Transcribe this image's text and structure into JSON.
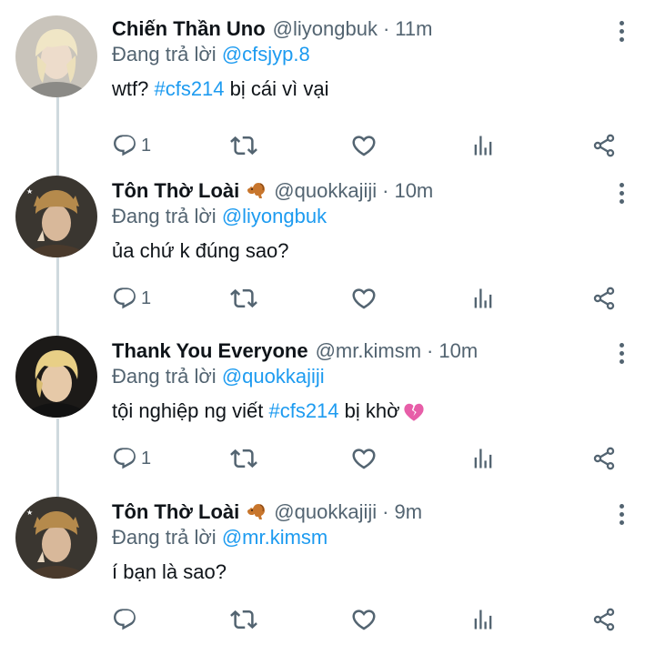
{
  "tweets": [
    {
      "name": "Chiến Thần Uno",
      "handle": "@liyongbuk",
      "separator": "·",
      "time": "11m",
      "reply_prefix": "Đang trả lời",
      "reply_to": "@cfsjyp.8",
      "text_before": "wtf? ",
      "hashtag": "#cfs214",
      "text_after": " bị cái vì vại",
      "reply_count": "1",
      "avatar": "avatar-blonde-person",
      "has_squirrel": false
    },
    {
      "name": "Tôn Thờ Loài",
      "handle": "@quokkajiji",
      "separator": "·",
      "time": "10m",
      "reply_prefix": "Đang trả lời",
      "reply_to": "@liyongbuk",
      "text": "ủa chứ k đúng sao?",
      "reply_count": "1",
      "avatar": "avatar-cat-hat-person",
      "has_squirrel": true
    },
    {
      "name": "Thank You Everyone",
      "handle": "@mr.kimsm",
      "separator": "·",
      "time": "10m",
      "reply_prefix": "Đang trả lời",
      "reply_to": "@quokkajiji",
      "text_before": "tội nghiệp ng viết ",
      "hashtag": "#cfs214",
      "text_after": " bị khờ",
      "reply_count": "1",
      "avatar": "avatar-blonde-dark-person",
      "has_squirrel": false,
      "trailing_emoji": "broken-heart-icon"
    },
    {
      "name": "Tôn Thờ Loài",
      "handle": "@quokkajiji",
      "separator": "·",
      "time": "9m",
      "reply_prefix": "Đang trả lời",
      "reply_to": "@mr.kimsm",
      "text": "í bạn là sao?",
      "reply_count": "",
      "avatar": "avatar-cat-hat-person",
      "has_squirrel": true
    }
  ],
  "icons": {
    "reply": "reply-icon",
    "retweet": "retweet-icon",
    "like": "heart-icon",
    "views": "analytics-icon",
    "share": "share-icon",
    "more": "more-options-icon",
    "emoji": "squirrel-emoji-icon"
  },
  "colors": {
    "accent": "#1d9bf0",
    "secondary_text": "#536471",
    "thread_line": "#cfd9de",
    "primary_text": "#0f1419"
  }
}
